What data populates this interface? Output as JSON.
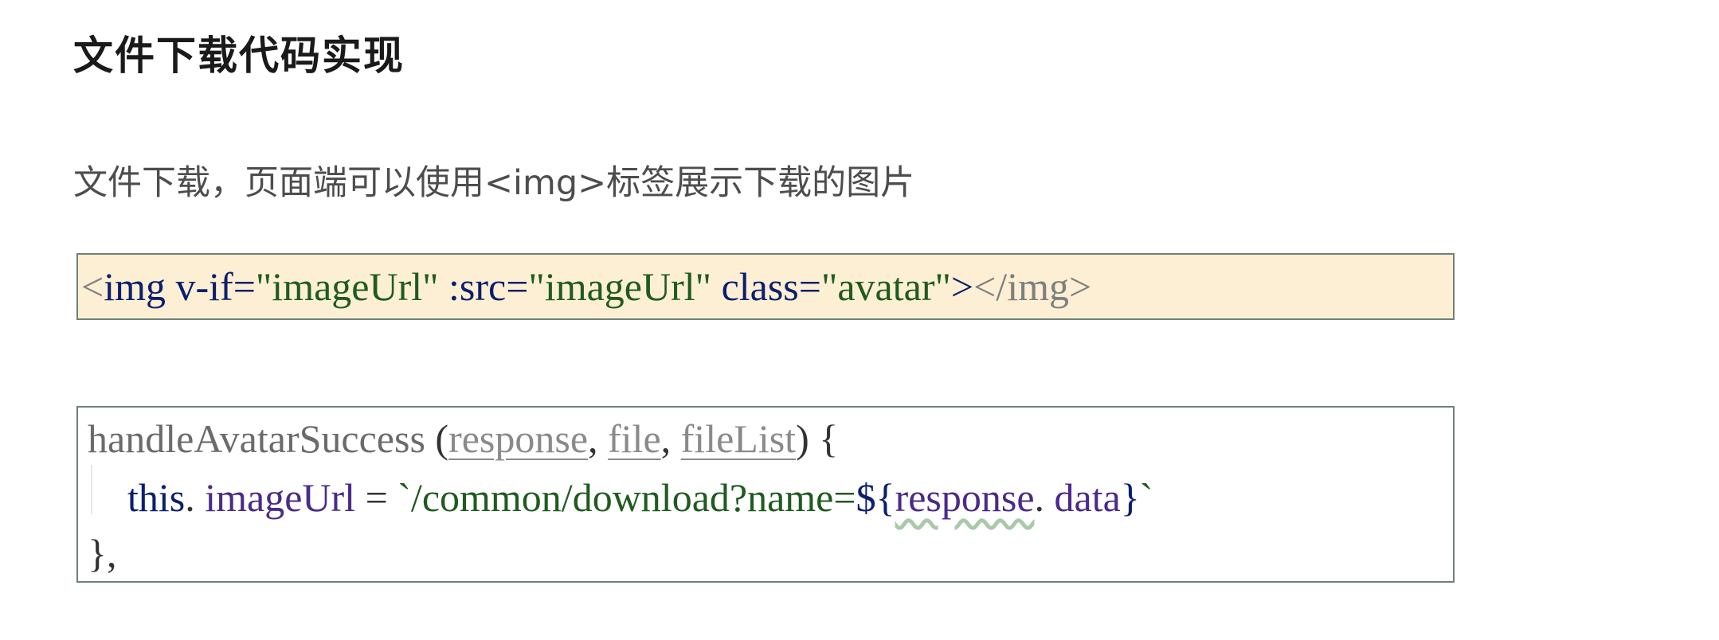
{
  "heading": "文件下载代码实现",
  "intro": "文件下载，页面端可以使用<img>标签展示下载的图片",
  "html_snippet": {
    "open_bracket": "<",
    "tag": "img",
    "attr1": " v-if=",
    "val1": "\"imageUrl\"",
    "attr2": " :src=",
    "val2": "\"imageUrl\"",
    "attr3": " class=",
    "val3": "\"avatar\"",
    "close": ">",
    "end_tag": "</img>"
  },
  "js_snippet": {
    "line1": {
      "fn": "handleAvatarSuccess ",
      "paren_open": "(",
      "p1": "response",
      "sep1": ", ",
      "p2": "file",
      "sep2": ", ",
      "p3": "fileList",
      "paren_close": ") {"
    },
    "line2": {
      "indent": "    ",
      "kw": "this",
      "dot": ". ",
      "field": "imageUrl",
      "op": " = ",
      "tpl_start": "`/common/download?name=",
      "interp_open": "${",
      "interp_var": "response",
      "interp_dot": ". ",
      "interp_field": "data",
      "interp_close": "}",
      "tpl_end": "`"
    },
    "line3": "},"
  }
}
